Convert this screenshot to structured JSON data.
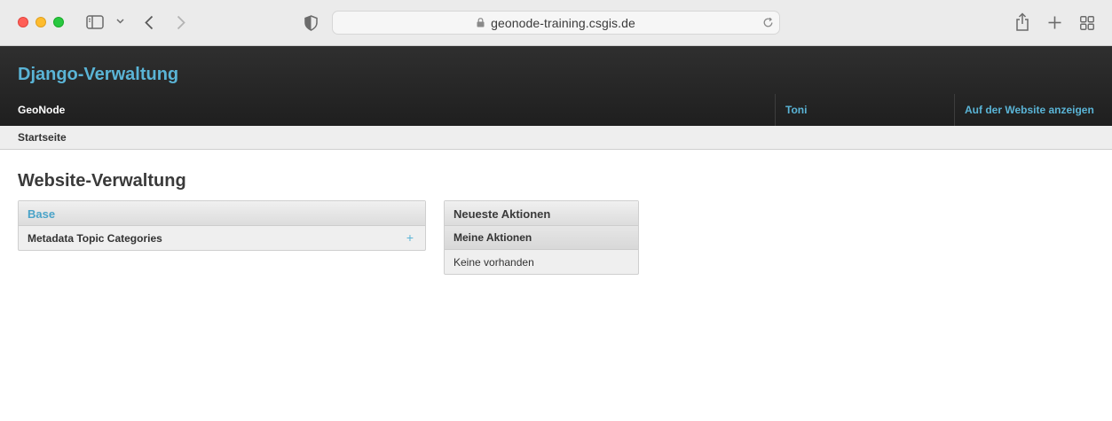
{
  "browser": {
    "url": "geonode-training.csgis.de"
  },
  "header": {
    "brand": "Django-Verwaltung",
    "nav": {
      "site": "GeoNode",
      "user": "Toni",
      "view_site": "Auf der Website anzeigen"
    }
  },
  "breadcrumbs": {
    "home": "Startseite"
  },
  "main": {
    "title": "Website-Verwaltung",
    "app_module": {
      "caption": "Base",
      "items": [
        {
          "label": "Metadata Topic Categories",
          "add_symbol": "+"
        }
      ]
    },
    "recent_actions": {
      "caption": "Neueste Aktionen",
      "subheading": "Meine Aktionen",
      "empty_text": "Keine vorhanden"
    }
  },
  "colors": {
    "link": "#5ab4d6",
    "header_bg": "#262626",
    "breadcrumb_bg": "#eeeeee"
  }
}
